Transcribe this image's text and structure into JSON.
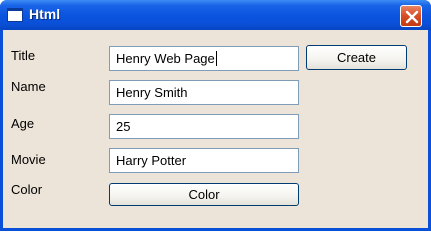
{
  "window": {
    "title": "Html"
  },
  "form": {
    "labels": {
      "title": "Title",
      "name": "Name",
      "age": "Age",
      "movie": "Movie",
      "color": "Color"
    },
    "fields": {
      "title": "Henry Web Page",
      "name": "Henry Smith",
      "age": "25",
      "movie": "Harry Potter"
    },
    "buttons": {
      "create": "Create",
      "color": "Color"
    }
  },
  "icons": {
    "app": "window-icon",
    "close": "close-icon"
  },
  "colors": {
    "titlebar": "#0a4fd8",
    "client_bg": "#ece4d8",
    "close_button": "#d64c24",
    "field_border": "#7f9db9",
    "button_border": "#003c74"
  }
}
